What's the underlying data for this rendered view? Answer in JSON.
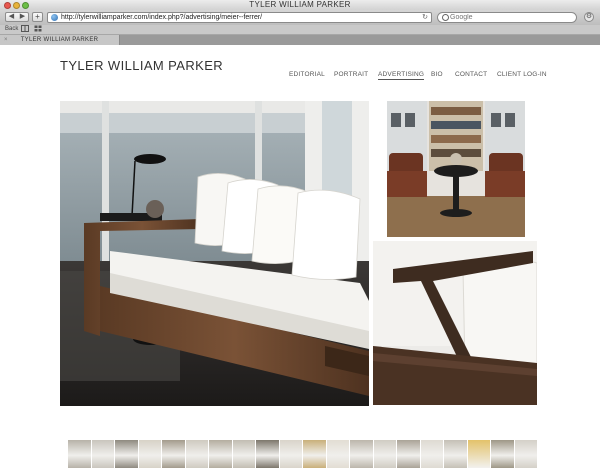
{
  "browser": {
    "window_title": "TYLER WILLIAM PARKER",
    "url": "http://tylerwilliamparker.com/index.php?/advertising/meier--ferrer/",
    "search_placeholder": "Google",
    "nav_back_glyph": "◀",
    "nav_forward_glyph": "▶",
    "new_tab_glyph": "+",
    "reload_glyph": "↻",
    "gear_glyph": "⚙",
    "bookmarks": [
      "Back",
      "book-icon",
      "grid-icon"
    ],
    "tab": {
      "label": "TYLER WILLIAM PARKER",
      "close_glyph": "×"
    }
  },
  "site": {
    "title": "TYLER WILLIAM PARKER",
    "nav": [
      "EDITORIAL",
      "PORTRAIT",
      "ADVERTISING",
      "BIO",
      "CONTACT",
      "CLIENT LOG-IN"
    ],
    "active_nav": "ADVERTISING"
  },
  "images": {
    "main": "living-room-sofa-photo",
    "top_right": "library-armchairs-photo",
    "bottom_right": "sofa-armrest-detail-photo"
  },
  "filmstrip": {
    "thumbnails": [
      "#b7b2a8",
      "#c9c5bd",
      "#8f8a80",
      "#d7d2c7",
      "#a39b8c",
      "#cfcac0",
      "#b4ad9f",
      "#c2bdb2",
      "#7d776c",
      "#d9d4ca",
      "#c9b07a",
      "#e2ddd3",
      "#bcb6ab",
      "#d0ccc3",
      "#aaa397",
      "#dedad2",
      "#c5c0b6",
      "#e8e4dc",
      "#9e9787",
      "#d4d0c8"
    ],
    "active_color": "#e3c26a"
  },
  "colors": {
    "accent_text": "#333333",
    "page_bg": "#ffffff"
  }
}
